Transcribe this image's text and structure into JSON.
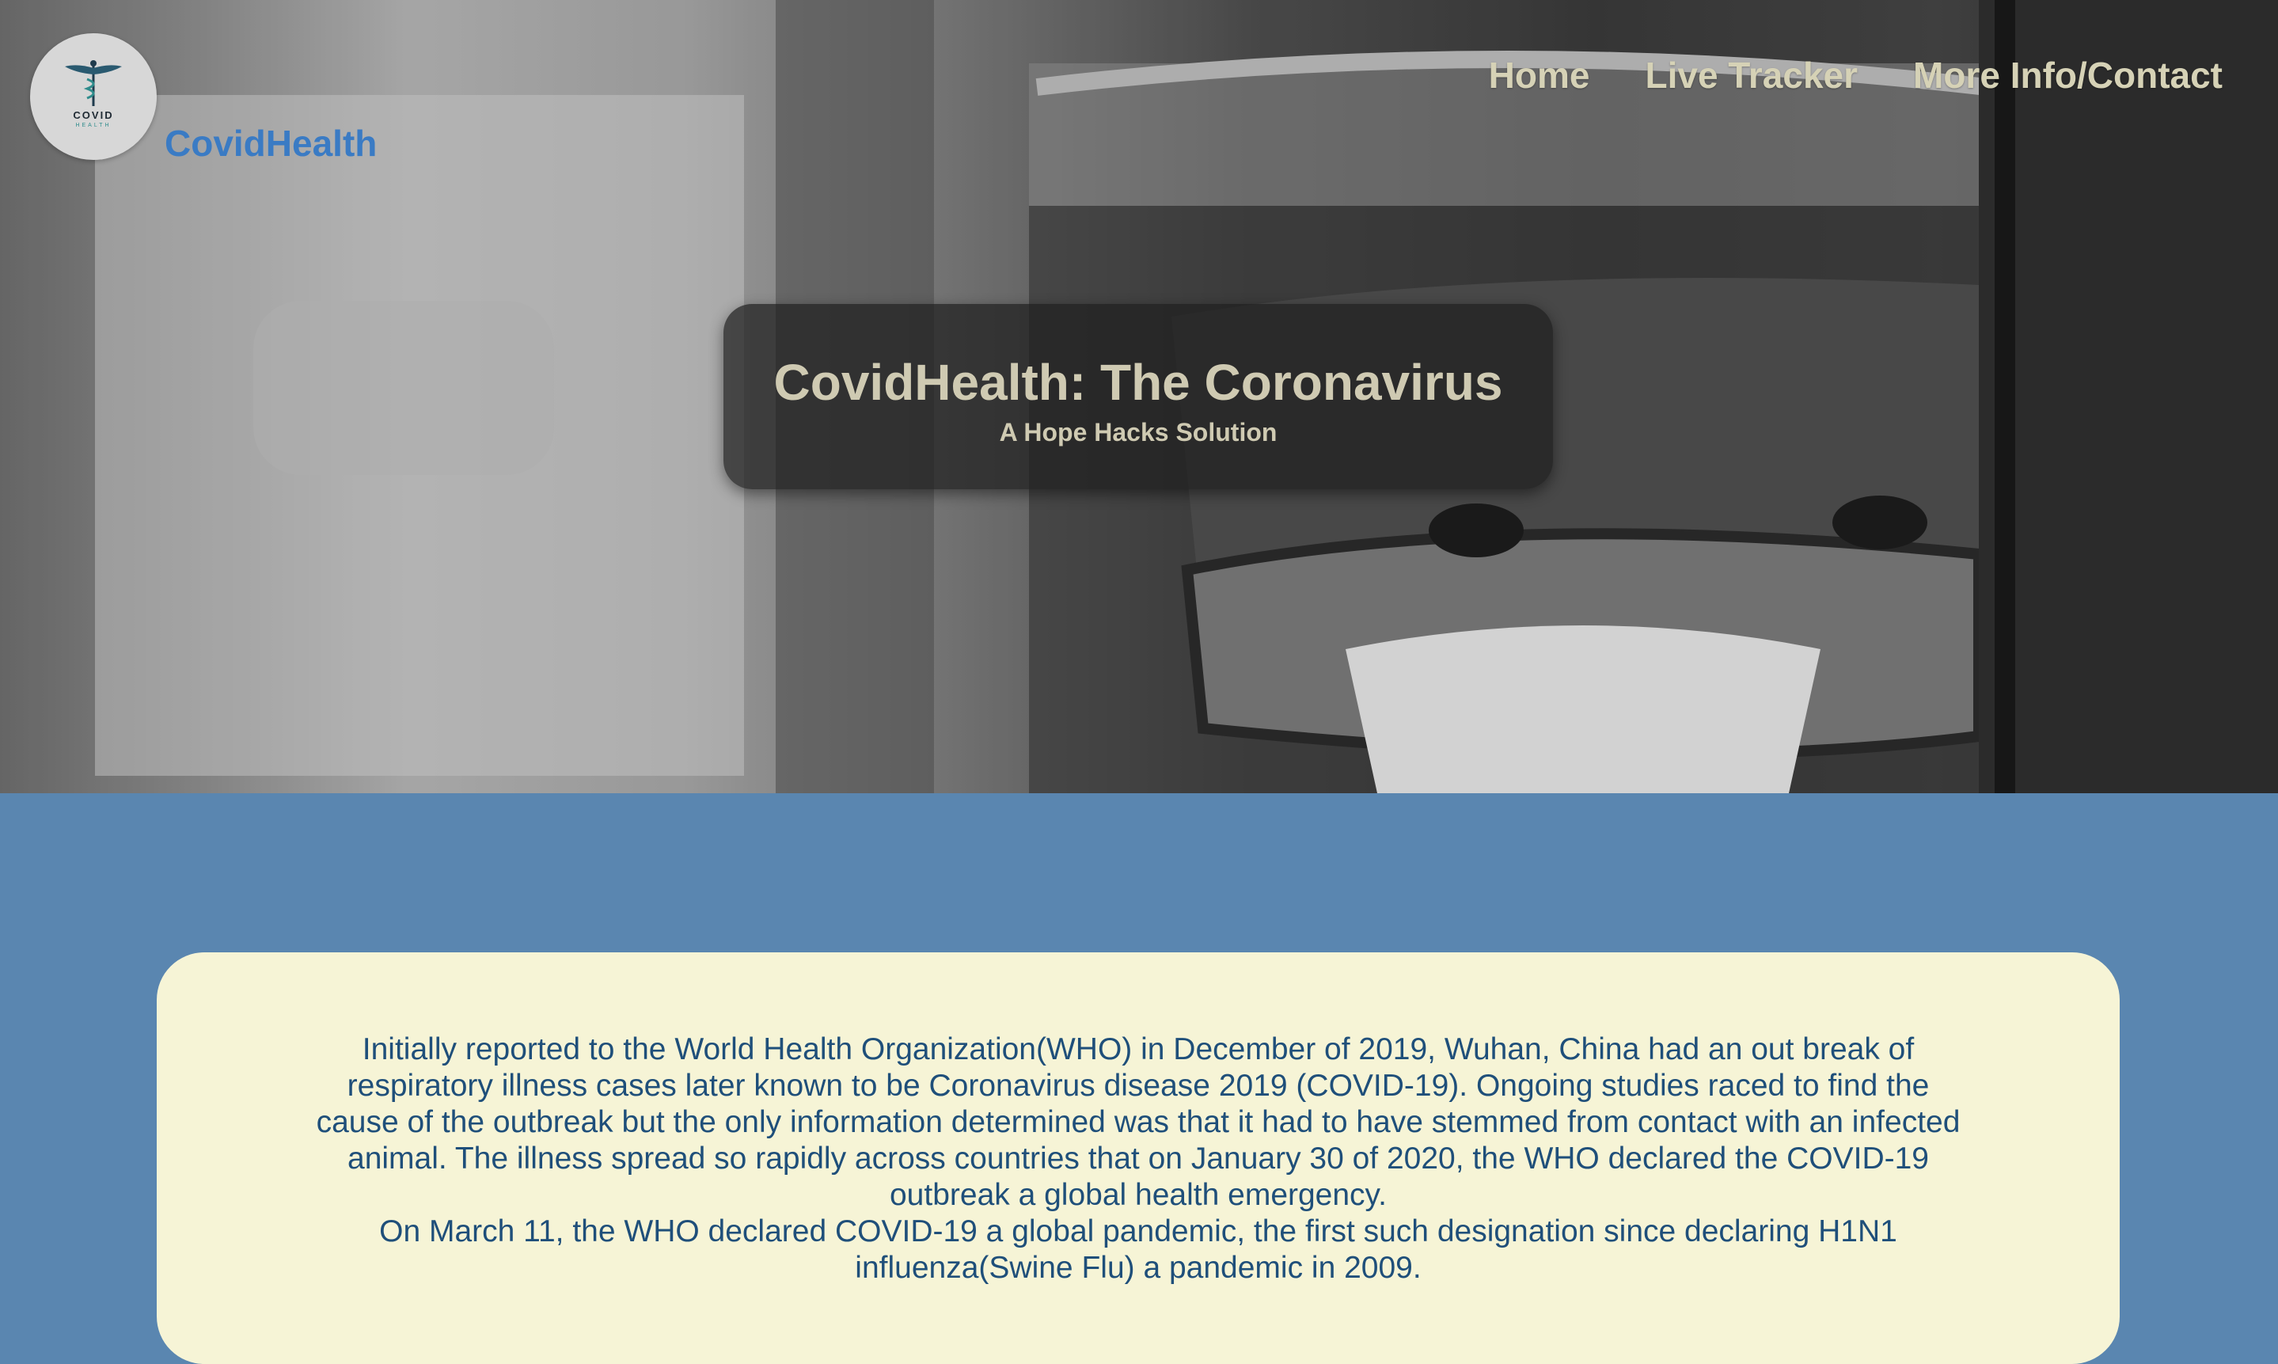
{
  "header": {
    "logo": {
      "icon": "caduceus-icon",
      "word": "COVID",
      "sub": "HEALTH"
    },
    "brand": "CovidHealth",
    "nav": [
      {
        "label": "Home"
      },
      {
        "label": "Live Tracker"
      },
      {
        "label": "More Info/Contact"
      }
    ]
  },
  "hero": {
    "title": "CovidHealth: The Coronavirus",
    "subtitle": "A Hope Hacks Solution"
  },
  "content": {
    "paragraphs": [
      "Initially reported to the World Health Organization(WHO) in December of 2019, Wuhan, China had an out break of respiratory illness cases later known to be Coronavirus disease 2019 (COVID-19). Ongoing studies raced to find the cause of the outbreak but the only information determined was that it had to have stemmed from contact with an infected animal. The illness spread so rapidly across countries that on January 30 of 2020, the WHO declared the COVID-19 outbreak a global health emergency.",
      "On March 11, the WHO declared COVID-19 a global pandemic, the first such designation since declaring H1N1 influenza(Swine Flu) a pandemic in 2009."
    ]
  },
  "colors": {
    "page_background": "#5a86b0",
    "card_background": "#f6f4d6",
    "body_text": "#1f4f7a",
    "brand": "#3a7bc4",
    "nav_text": "#d6d2b6"
  }
}
